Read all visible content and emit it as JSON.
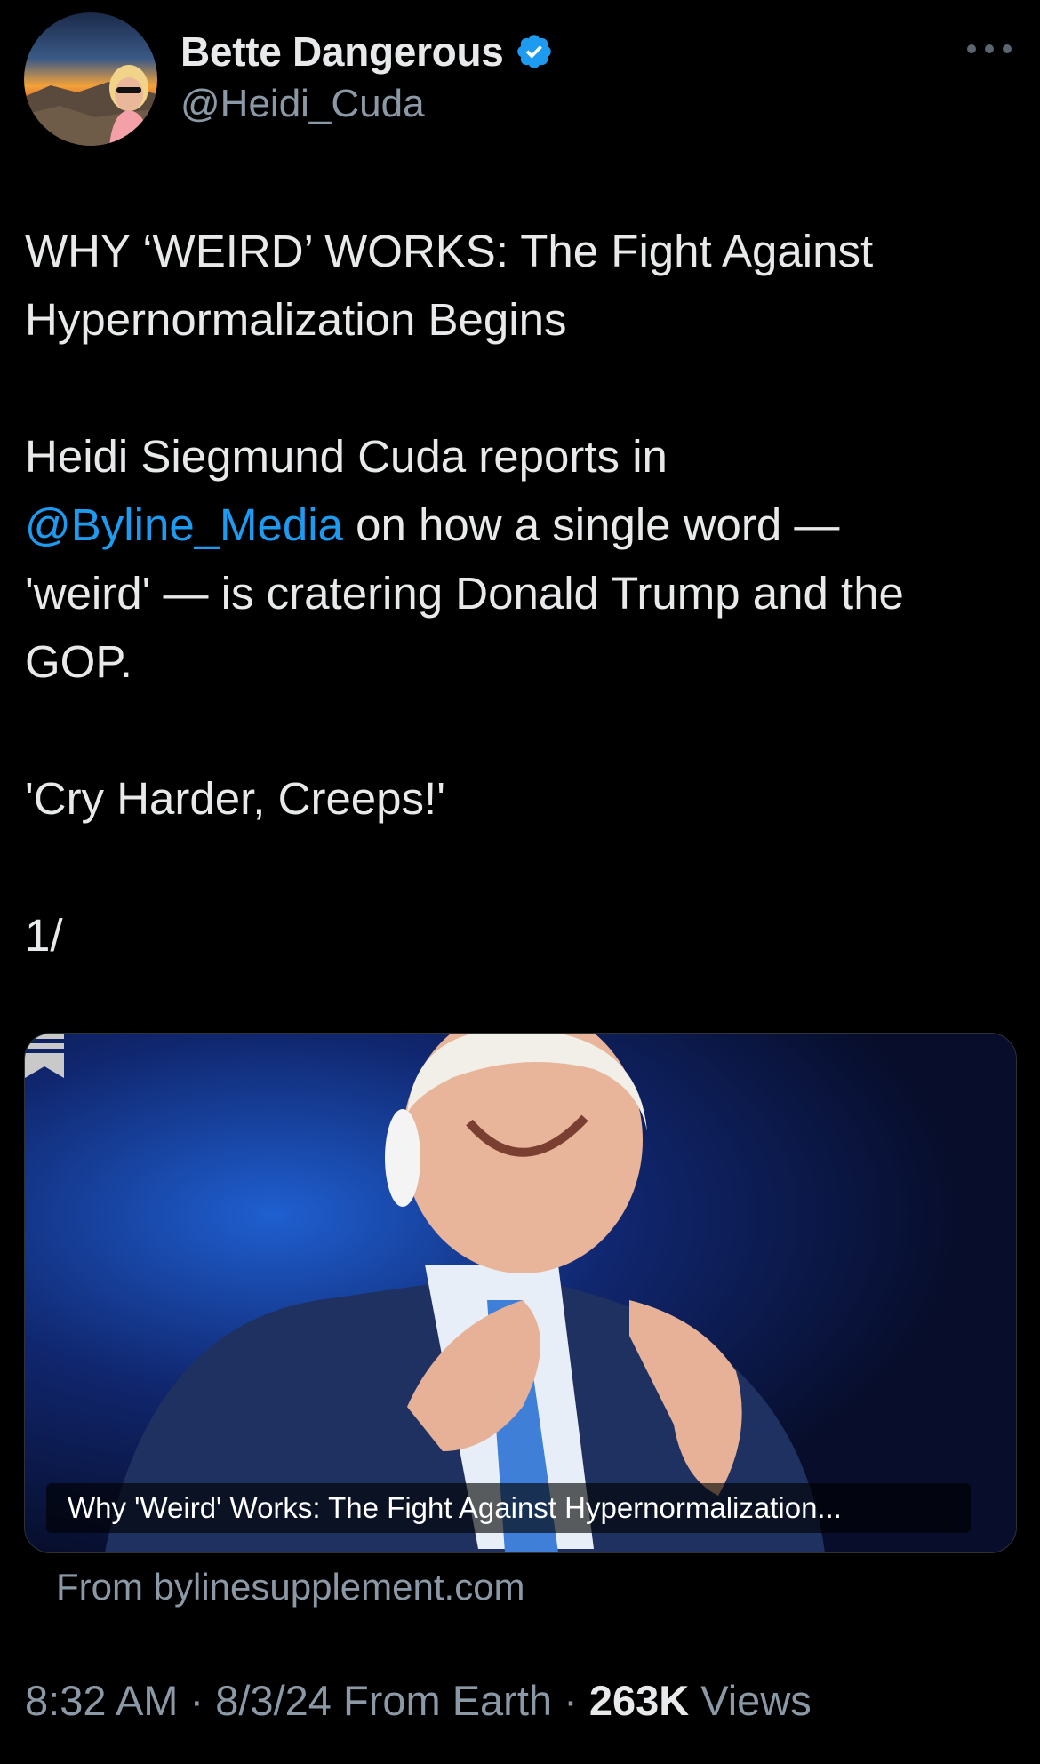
{
  "author": {
    "display_name": "Bette Dangerous",
    "handle": "@Heidi_Cuda",
    "verified_icon": "verified-badge-icon"
  },
  "menu_icon": "more-horizontal-icon",
  "tweet": {
    "line1": "WHY ‘WEIRD’ WORKS: The Fight Against\nHypernormalization Begins",
    "para2_start": "Heidi Siegmund Cuda reports in\n",
    "mention": "@Byline_Media",
    "para2_end": " on how a single word —\n'weird' — is cratering Donald Trump and the\nGOP.",
    "line3": "'Cry Harder, Creeps!'",
    "line4": "1/"
  },
  "card": {
    "title": "Why 'Weird' Works: The Fight Against Hypernormalization...",
    "source": "From bylinesupplement.com",
    "icon": "substack-bookmark-icon"
  },
  "meta": {
    "time": "8:32 AM",
    "date": "8/3/24",
    "location": "From Earth",
    "views_count": "263K",
    "views_label": "Views"
  },
  "colors": {
    "background": "#000000",
    "text": "#e7e9ea",
    "secondary": "#8b98a5",
    "link": "#1d9bf0",
    "verified": "#1d9bf0"
  }
}
